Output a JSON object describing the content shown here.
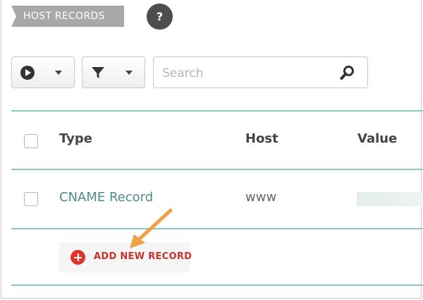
{
  "header": {
    "section_label": "HOST RECORDS",
    "help_label": "?"
  },
  "toolbar": {
    "actions_dropdown": {
      "icon": "play-circle-icon"
    },
    "filter_dropdown": {
      "icon": "filter-icon"
    },
    "search": {
      "placeholder": "Search",
      "value": ""
    }
  },
  "table": {
    "columns": [
      "Type",
      "Host",
      "Value"
    ],
    "rows": [
      {
        "type": "CNAME Record",
        "host": "www",
        "value": ""
      }
    ]
  },
  "add_record": {
    "label": "ADD NEW RECORD"
  },
  "colors": {
    "accent_teal": "#8cc7c9",
    "record_type_text": "#4f8a8b",
    "add_red": "#e0322f",
    "annotation_arrow": "#f0a046"
  }
}
